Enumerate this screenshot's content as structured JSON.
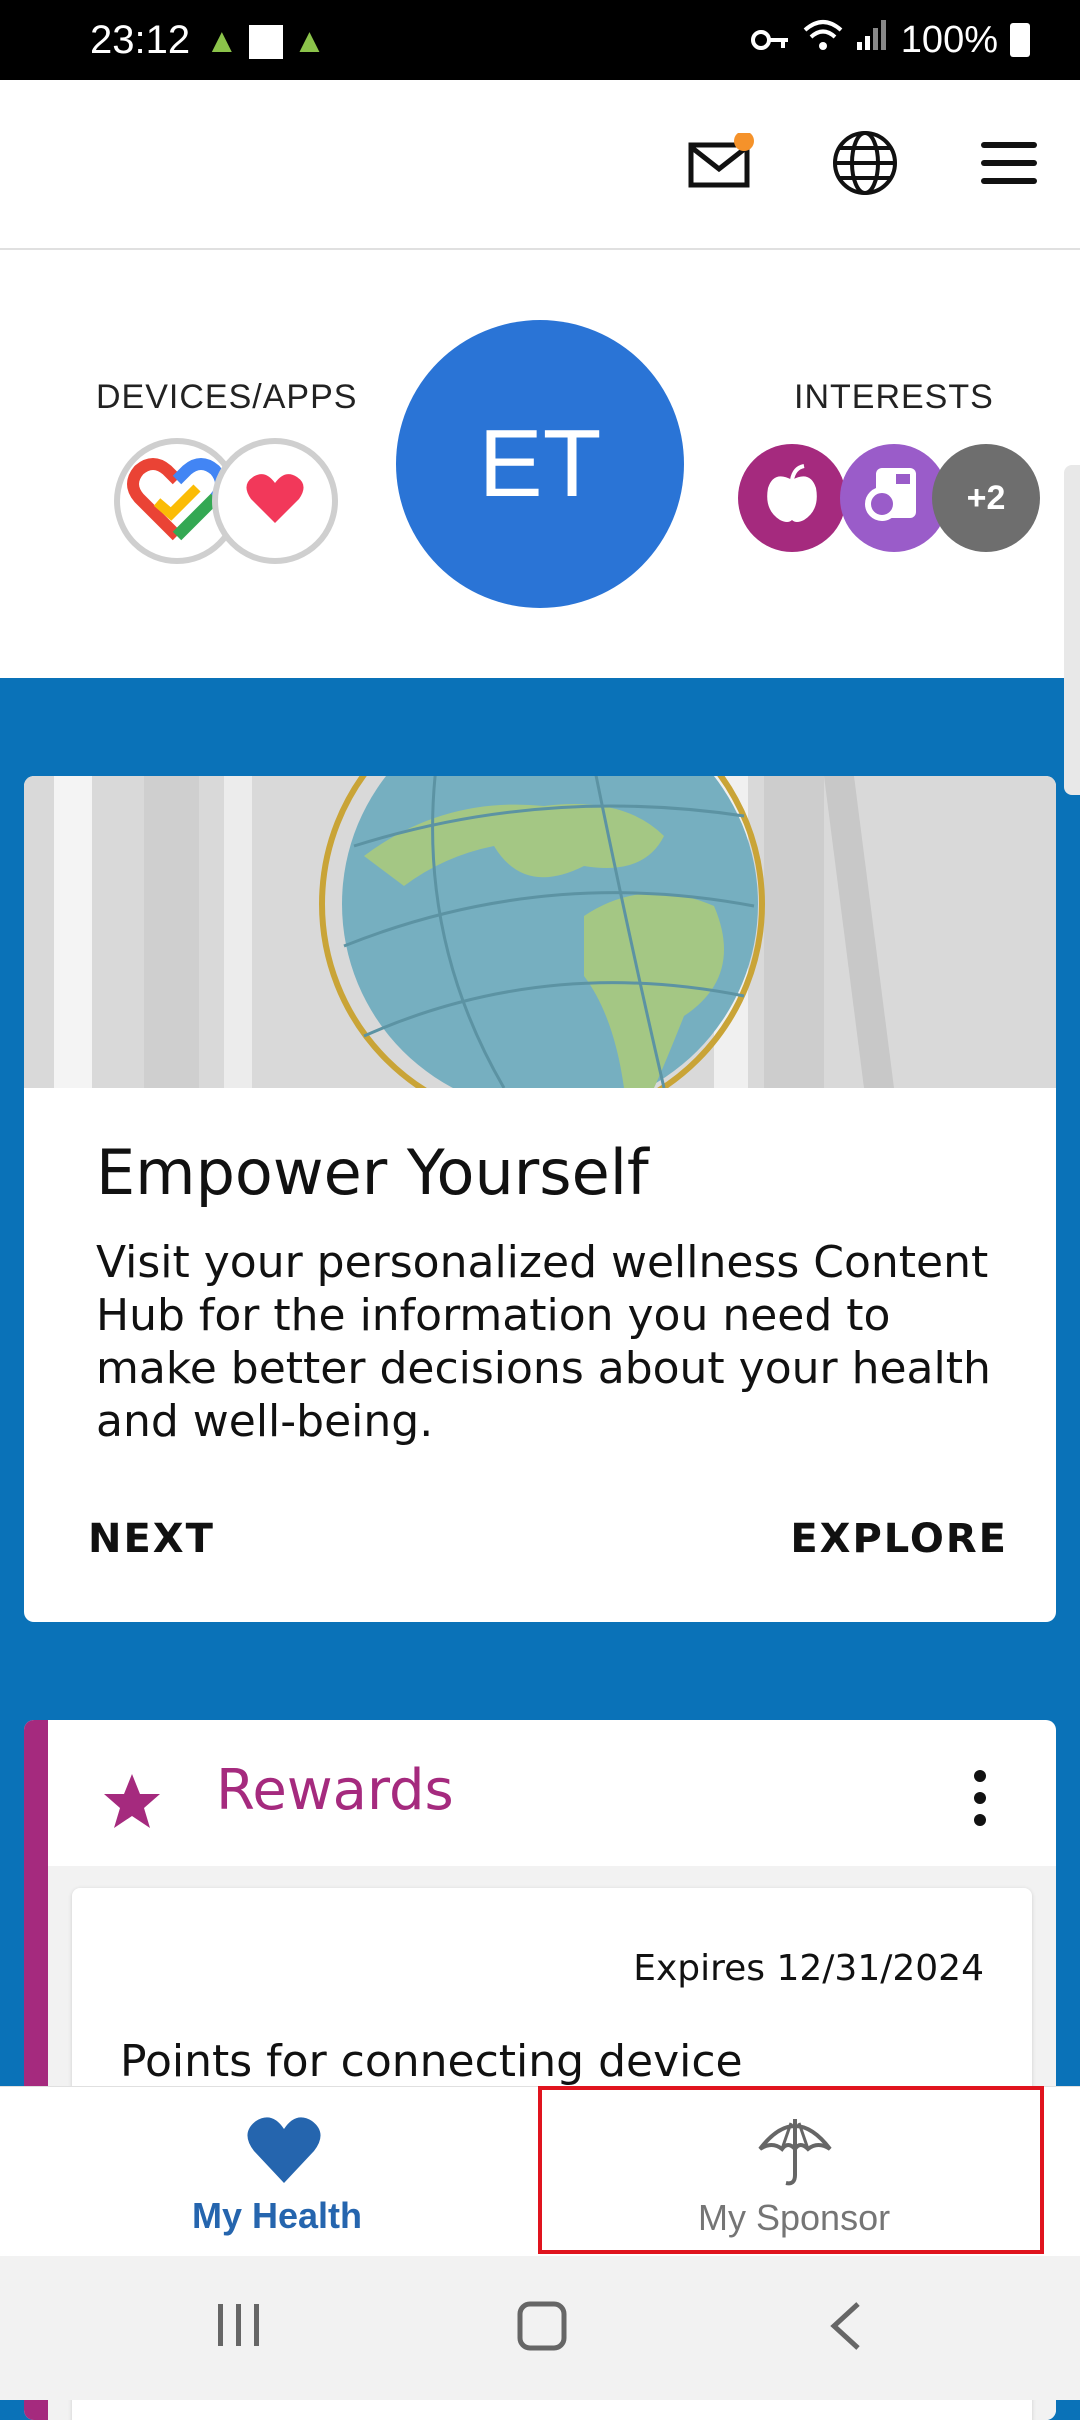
{
  "status_bar": {
    "time": "23:12",
    "battery": "100%"
  },
  "header": {
    "icons": [
      "mail-icon",
      "globe-icon",
      "menu-icon"
    ],
    "notification_color": "#f5922a"
  },
  "profile": {
    "devices_label": "DEVICES/APPS",
    "avatar_initials": "ET",
    "interests_label": "INTERESTS",
    "interests_more": "+2",
    "avatar_color": "#2a74d6"
  },
  "card": {
    "title": "Empower Yourself",
    "description": "Visit your personalized wellness Content Hub for the information you need to make better decisions about your health and well-being.",
    "next_label": "NEXT",
    "explore_label": "EXPLORE"
  },
  "rewards": {
    "title": "Rewards",
    "expires": "Expires 12/31/2024",
    "item_text": "Points for connecting device",
    "accent_color": "#a52a7e"
  },
  "bottom_nav": {
    "items": [
      {
        "label": "My Health",
        "icon": "heart-icon",
        "active": true
      },
      {
        "label": "My Sponsor",
        "icon": "umbrella-icon",
        "active": false
      }
    ]
  },
  "colors": {
    "background": "#0a72b8",
    "active_nav": "#2565ae",
    "highlight": "#e0141e"
  }
}
